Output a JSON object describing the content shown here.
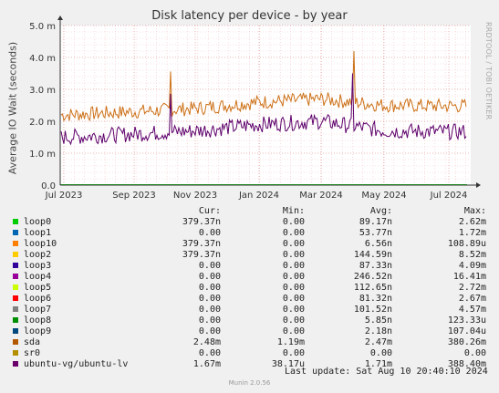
{
  "chart_data": {
    "type": "line",
    "title": "Disk latency per device - by year",
    "ylabel": "Average IO Wait (seconds)",
    "ylim": [
      0,
      0.005
    ],
    "y_ticks": [
      "0.0",
      "1.0 m",
      "2.0 m",
      "3.0 m",
      "4.0 m",
      "5.0 m"
    ],
    "x_ticks": [
      "Jul 2023",
      "Sep 2023",
      "Nov 2023",
      "Jan 2024",
      "Mar 2024",
      "May 2024",
      "Jul 2024"
    ],
    "grid": true,
    "series": [
      {
        "name": "sda",
        "color": "#cc7016",
        "points": [
          [
            "Jul 2023",
            0.0022
          ],
          [
            "Sep 2023",
            0.0023
          ],
          [
            "Nov 2023",
            0.0024
          ],
          [
            "Jan 2024",
            0.0026
          ],
          [
            "Mar 2024",
            0.0027
          ],
          [
            "May 2024",
            0.0025
          ],
          [
            "Jul 2024",
            0.00248
          ]
        ],
        "peak": 0.0042
      },
      {
        "name": "ubuntu-vg/ubuntu-lv",
        "color": "#5d006b",
        "points": [
          [
            "Jul 2023",
            0.0015
          ],
          [
            "Sep 2023",
            0.0016
          ],
          [
            "Nov 2023",
            0.0017
          ],
          [
            "Jan 2024",
            0.0019
          ],
          [
            "Mar 2024",
            0.002
          ],
          [
            "May 2024",
            0.0017
          ],
          [
            "Jul 2024",
            0.00167
          ]
        ],
        "peak": 0.0035
      }
    ]
  },
  "legend": {
    "headers": {
      "cur": "Cur:",
      "min": "Min:",
      "avg": "Avg:",
      "max": "Max:"
    },
    "rows": [
      {
        "name": "loop0",
        "color": "#00cc00",
        "cur": "379.37n",
        "min": "0.00",
        "avg": "89.17n",
        "max": "2.62m"
      },
      {
        "name": "loop1",
        "color": "#0066b3",
        "cur": "0.00",
        "min": "0.00",
        "avg": "53.77n",
        "max": "1.72m"
      },
      {
        "name": "loop10",
        "color": "#ff8000",
        "cur": "379.37n",
        "min": "0.00",
        "avg": "6.56n",
        "max": "108.89u"
      },
      {
        "name": "loop2",
        "color": "#ffcc00",
        "cur": "379.37n",
        "min": "0.00",
        "avg": "144.59n",
        "max": "8.52m"
      },
      {
        "name": "loop3",
        "color": "#330099",
        "cur": "0.00",
        "min": "0.00",
        "avg": "87.33n",
        "max": "4.09m"
      },
      {
        "name": "loop4",
        "color": "#990099",
        "cur": "0.00",
        "min": "0.00",
        "avg": "246.52n",
        "max": "16.41m"
      },
      {
        "name": "loop5",
        "color": "#ccff00",
        "cur": "0.00",
        "min": "0.00",
        "avg": "112.65n",
        "max": "2.72m"
      },
      {
        "name": "loop6",
        "color": "#ff0000",
        "cur": "0.00",
        "min": "0.00",
        "avg": "81.32n",
        "max": "2.67m"
      },
      {
        "name": "loop7",
        "color": "#808080",
        "cur": "0.00",
        "min": "0.00",
        "avg": "101.52n",
        "max": "4.57m"
      },
      {
        "name": "loop8",
        "color": "#008f00",
        "cur": "0.00",
        "min": "0.00",
        "avg": "5.85n",
        "max": "123.33u"
      },
      {
        "name": "loop9",
        "color": "#00487d",
        "cur": "0.00",
        "min": "0.00",
        "avg": "2.18n",
        "max": "107.04u"
      },
      {
        "name": "sda",
        "color": "#b35a00",
        "cur": "2.48m",
        "min": "1.19m",
        "avg": "2.47m",
        "max": "380.26m"
      },
      {
        "name": "sr0",
        "color": "#b38f00",
        "cur": "0.00",
        "min": "0.00",
        "avg": "0.00",
        "max": "0.00"
      },
      {
        "name": "ubuntu-vg/ubuntu-lv",
        "color": "#6b006b",
        "cur": "1.67m",
        "min": "38.17u",
        "avg": "1.71m",
        "max": "388.40m"
      }
    ]
  },
  "footer": {
    "last_update": "Last update: Sat Aug 10 20:40:10 2024",
    "munin": "Munin 2.0.56"
  },
  "side_label": "RRDTOOL / TOBI OETIKER"
}
